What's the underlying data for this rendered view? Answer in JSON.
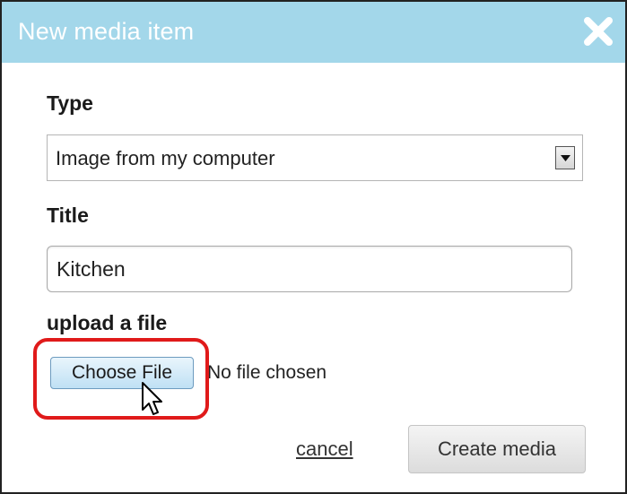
{
  "dialog": {
    "title": "New media item",
    "close_icon": "close-icon",
    "colors": {
      "titlebar": "#a3d7ea",
      "title_text": "#ffffff",
      "annotation_ring": "#e01a1a"
    }
  },
  "form": {
    "type": {
      "label": "Type",
      "selected_value": "Image from my computer"
    },
    "title": {
      "label": "Title",
      "value": "Kitchen"
    },
    "upload": {
      "label": "upload a file",
      "button_label": "Choose File",
      "status_text": "No file chosen"
    }
  },
  "actions": {
    "cancel_label": "cancel",
    "create_label": "Create media"
  }
}
